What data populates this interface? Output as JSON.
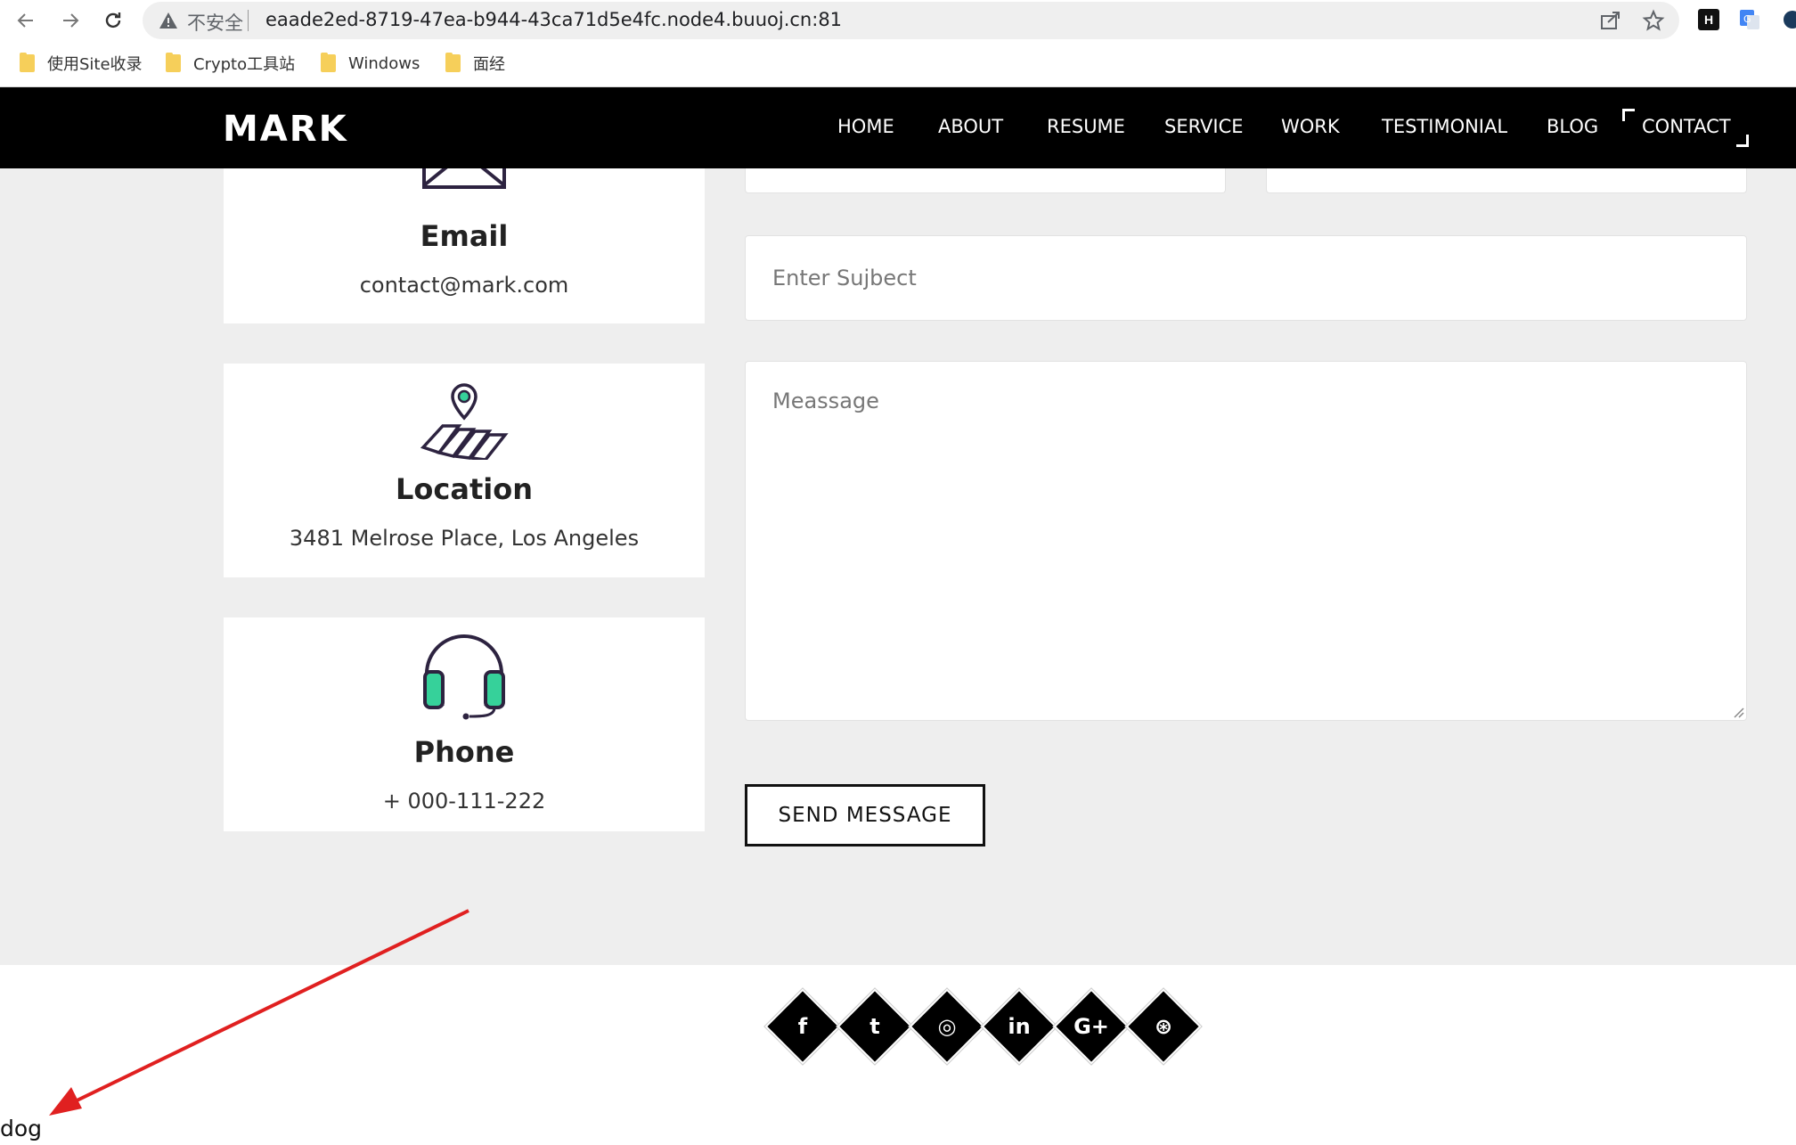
{
  "browser": {
    "security_label": "不安全",
    "url": "eaade2ed-8719-47ea-b944-43ca71d5e4fc.node4.buuoj.cn:81",
    "bookmarks": [
      "使用Site收录",
      "Crypto工具站",
      "Windows",
      "面经"
    ],
    "extension_badge": "H"
  },
  "site": {
    "logo": "MARK",
    "nav": [
      "HOME",
      "ABOUT",
      "RESUME",
      "SERVICE",
      "WORK",
      "TESTIMONIAL",
      "BLOG",
      "CONTACT"
    ],
    "active_nav": "CONTACT",
    "cards": [
      {
        "title": "Email",
        "value": "contact@mark.com"
      },
      {
        "title": "Location",
        "value": "3481 Melrose Place, Los Angeles"
      },
      {
        "title": "Phone",
        "value": "+ 000-111-222"
      }
    ],
    "form": {
      "subject_placeholder": "Enter Sujbect",
      "message_placeholder": "Meassage",
      "send_label": "SEND MESSAGE"
    },
    "social_icons": [
      "facebook-icon",
      "twitter-icon",
      "instagram-icon",
      "linkedin-icon",
      "google-plus-icon",
      "dribbble-icon"
    ],
    "social_glyphs": [
      "f",
      "t",
      "◎",
      "in",
      "G+",
      "⊛"
    ]
  },
  "annotation": {
    "text": "dog",
    "arrow_color": "#e02020"
  }
}
